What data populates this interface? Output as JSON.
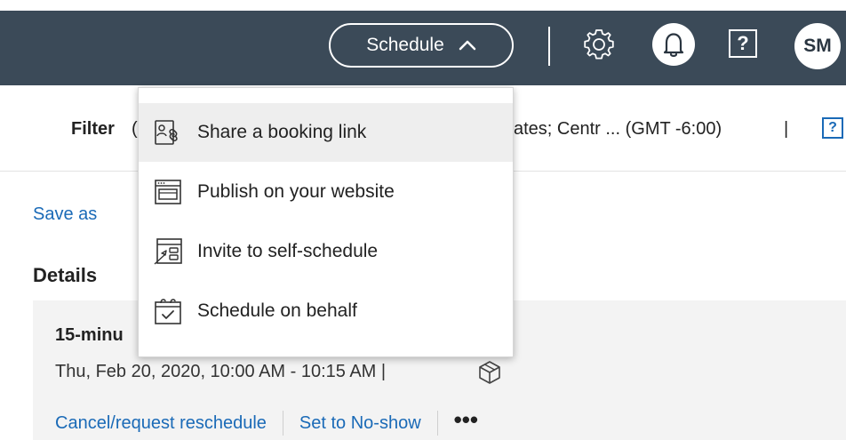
{
  "topbar": {
    "schedule_label": "Schedule",
    "help_label": "?",
    "avatar_initials": "SM"
  },
  "filter": {
    "label": "Filter",
    "paren": "(",
    "timezone_text": "ates; Centr ... (GMT -6:00)",
    "separator": "|",
    "help_label": "?"
  },
  "save_as": "Save as",
  "details_heading": "Details",
  "appointment": {
    "title": "15-minu",
    "time": "Thu, Feb 20, 2020, 10:00 AM - 10:15 AM  |",
    "actions": {
      "cancel": "Cancel/request reschedule",
      "noshow": "Set to No-show",
      "more": "•••"
    }
  },
  "dropdown": {
    "items": [
      {
        "label": "Share a booking link",
        "icon": "share-link-icon",
        "highlighted": true
      },
      {
        "label": "Publish on your website",
        "icon": "website-icon",
        "highlighted": false
      },
      {
        "label": "Invite to self-schedule",
        "icon": "invite-icon",
        "highlighted": false
      },
      {
        "label": "Schedule on behalf",
        "icon": "calendar-check-icon",
        "highlighted": false
      }
    ]
  },
  "colors": {
    "topbar_bg": "#3b4a58",
    "link": "#1a6ab7",
    "card_bg": "#f3f3f3",
    "highlight": "#eeeeee"
  }
}
